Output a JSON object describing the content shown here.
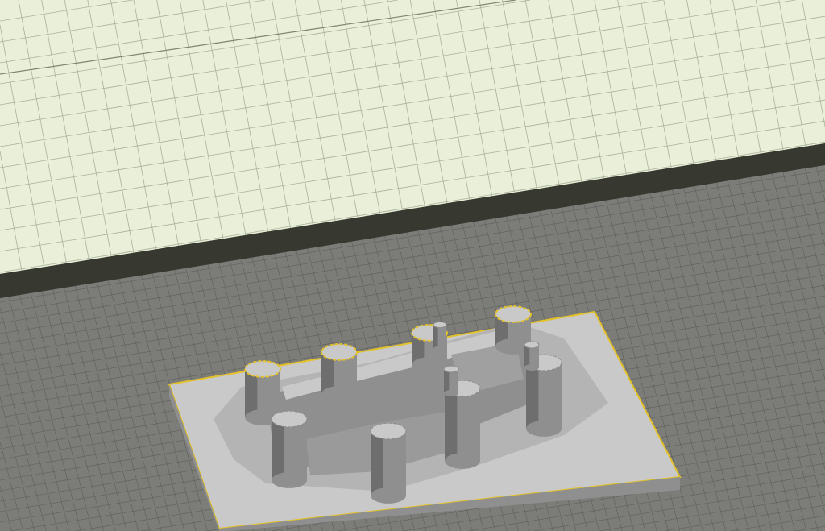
{
  "viewport": {
    "name": "3d-build-plate-view",
    "colors": {
      "plate_top": "#e9efd8",
      "plate_edge": "#37382f",
      "floor": "#7c7c79",
      "grid_light": "#aab29a",
      "grid_dark": "#5f5f5c",
      "model_top": "#c9c9c9",
      "model_side": "#8f8f8f",
      "model_dark": "#6e6e6e",
      "selection_outline": "#e2c12a"
    },
    "model": {
      "name": "castle-model",
      "selected": true
    }
  }
}
